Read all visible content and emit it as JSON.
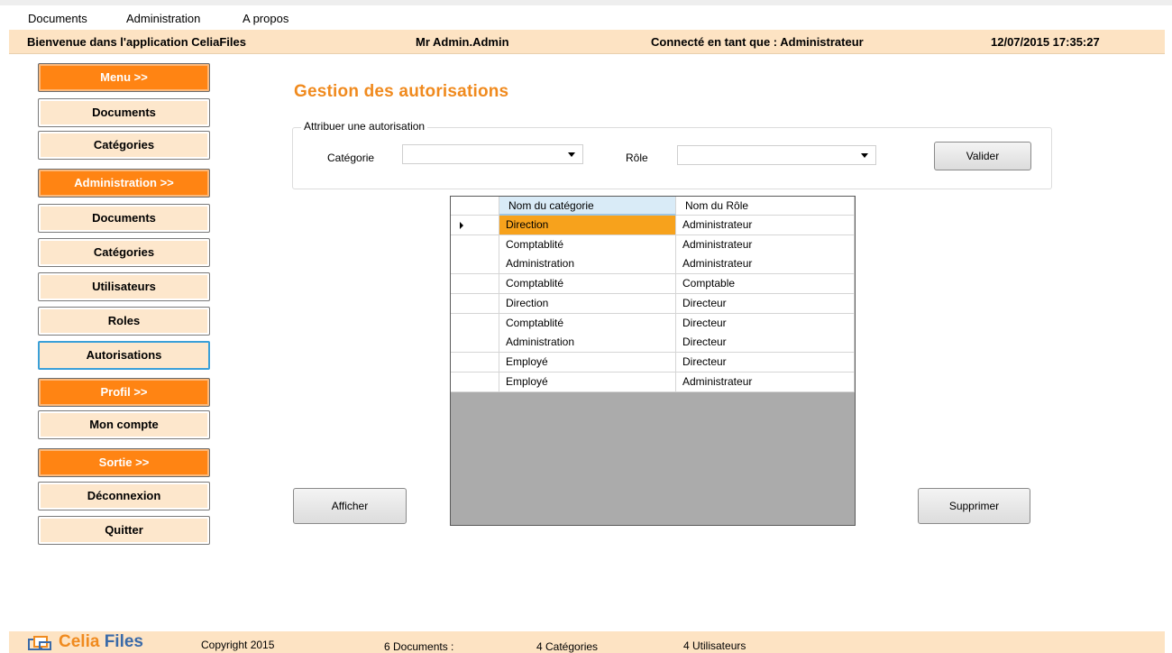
{
  "menubar": {
    "items": [
      "Documents",
      "Administration",
      "A propos"
    ]
  },
  "header": {
    "welcome": "Bienvenue dans l'application CeliaFiles",
    "user": "Mr Admin.Admin",
    "role": "Connecté en tant que : Administrateur",
    "datetime": "12/07/2015 17:35:27"
  },
  "sidebar": {
    "buttons": [
      {
        "label": "Menu >>"
      },
      {
        "label": "Documents"
      },
      {
        "label": "Catégories"
      },
      {
        "label": "Administration >>"
      },
      {
        "label": "Documents"
      },
      {
        "label": "Catégories"
      },
      {
        "label": "Utilisateurs"
      },
      {
        "label": "Roles"
      },
      {
        "label": "Autorisations"
      },
      {
        "label": "Profil >>"
      },
      {
        "label": "Mon compte"
      },
      {
        "label": "Sortie >>"
      },
      {
        "label": "Déconnexion"
      },
      {
        "label": "Quitter"
      }
    ]
  },
  "main": {
    "title": "Gestion des autorisations",
    "group_legend": "Attribuer une autorisation",
    "categorie_label": "Catégorie",
    "categorie_value": "",
    "role_label": "Rôle",
    "role_value": "",
    "valider_label": "Valider",
    "afficher_label": "Afficher",
    "supprimer_label": "Supprimer"
  },
  "grid": {
    "columns": [
      "Nom du catégorie",
      "Nom du Rôle"
    ],
    "rows": [
      [
        "Direction",
        "Administrateur"
      ],
      [
        "Comptablité",
        "Administrateur"
      ],
      [
        "Administration",
        "Administrateur"
      ],
      [
        "Comptablité",
        "Comptable"
      ],
      [
        "Direction",
        "Directeur"
      ],
      [
        "Comptablité",
        "Directeur"
      ],
      [
        "Administration",
        "Directeur"
      ],
      [
        "Employé",
        "Directeur"
      ],
      [
        "Employé",
        "Administrateur"
      ]
    ]
  },
  "footer": {
    "logo_part1": "Celia",
    "logo_part2": "Files",
    "copyright": "Copyright 2015",
    "documents": "6  Documents :",
    "categories": "4  Catégories",
    "utilisateurs": "4  Utilisateurs"
  },
  "colors": {
    "accent": "#ff8413",
    "header_bg": "#fde3c3",
    "selection": "#f7a21c",
    "title": "#f08a1e"
  }
}
